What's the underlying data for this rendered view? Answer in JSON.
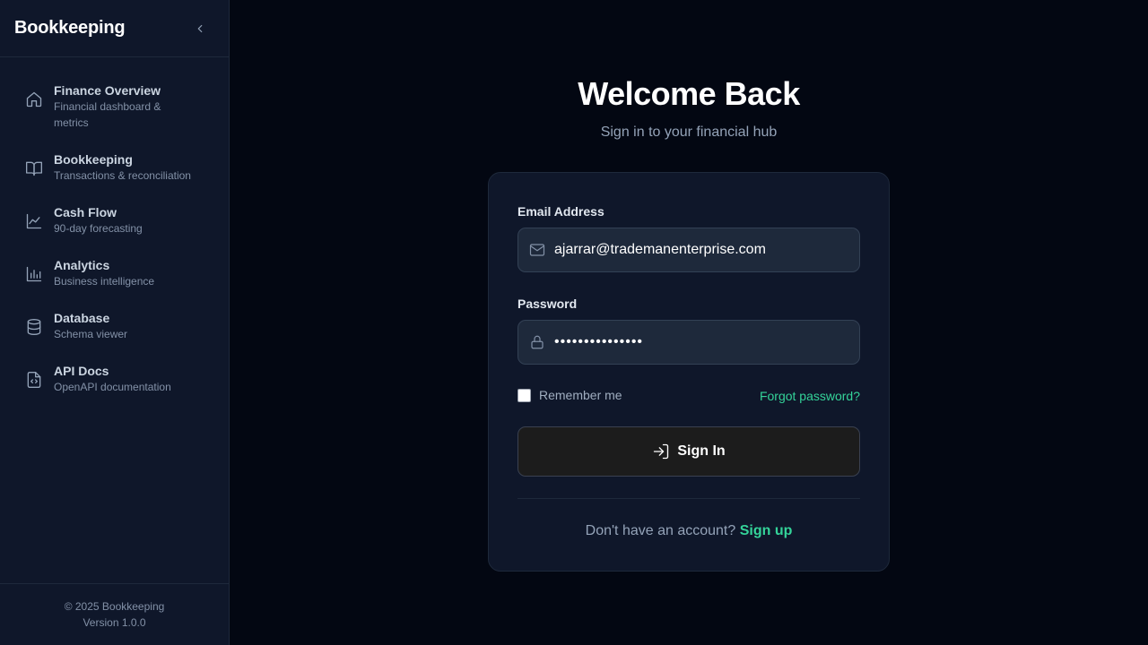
{
  "sidebar": {
    "brand": "Bookkeeping",
    "items": [
      {
        "title": "Finance Overview",
        "subtitle": "Financial dashboard & metrics",
        "icon": "home-icon"
      },
      {
        "title": "Bookkeeping",
        "subtitle": "Transactions & reconciliation",
        "icon": "book-icon"
      },
      {
        "title": "Cash Flow",
        "subtitle": "90-day forecasting",
        "icon": "line-chart-icon"
      },
      {
        "title": "Analytics",
        "subtitle": "Business intelligence",
        "icon": "bar-chart-icon"
      },
      {
        "title": "Database",
        "subtitle": "Schema viewer",
        "icon": "database-icon"
      },
      {
        "title": "API Docs",
        "subtitle": "OpenAPI documentation",
        "icon": "code-file-icon"
      }
    ],
    "footer": {
      "copyright": "© 2025 Bookkeeping",
      "version": "Version 1.0.0"
    }
  },
  "login": {
    "title": "Welcome Back",
    "subtitle": "Sign in to your financial hub",
    "email_label": "Email Address",
    "email_value": "ajarrar@trademanenterprise.com",
    "password_label": "Password",
    "password_value": "•••••••••••••••",
    "remember_label": "Remember me",
    "forgot_label": "Forgot password?",
    "signin_label": "Sign In",
    "signup_prompt": "Don't have an account?",
    "signup_label": "Sign up"
  },
  "colors": {
    "accent": "#34d399",
    "background": "#030712",
    "panel": "#0f172a"
  }
}
